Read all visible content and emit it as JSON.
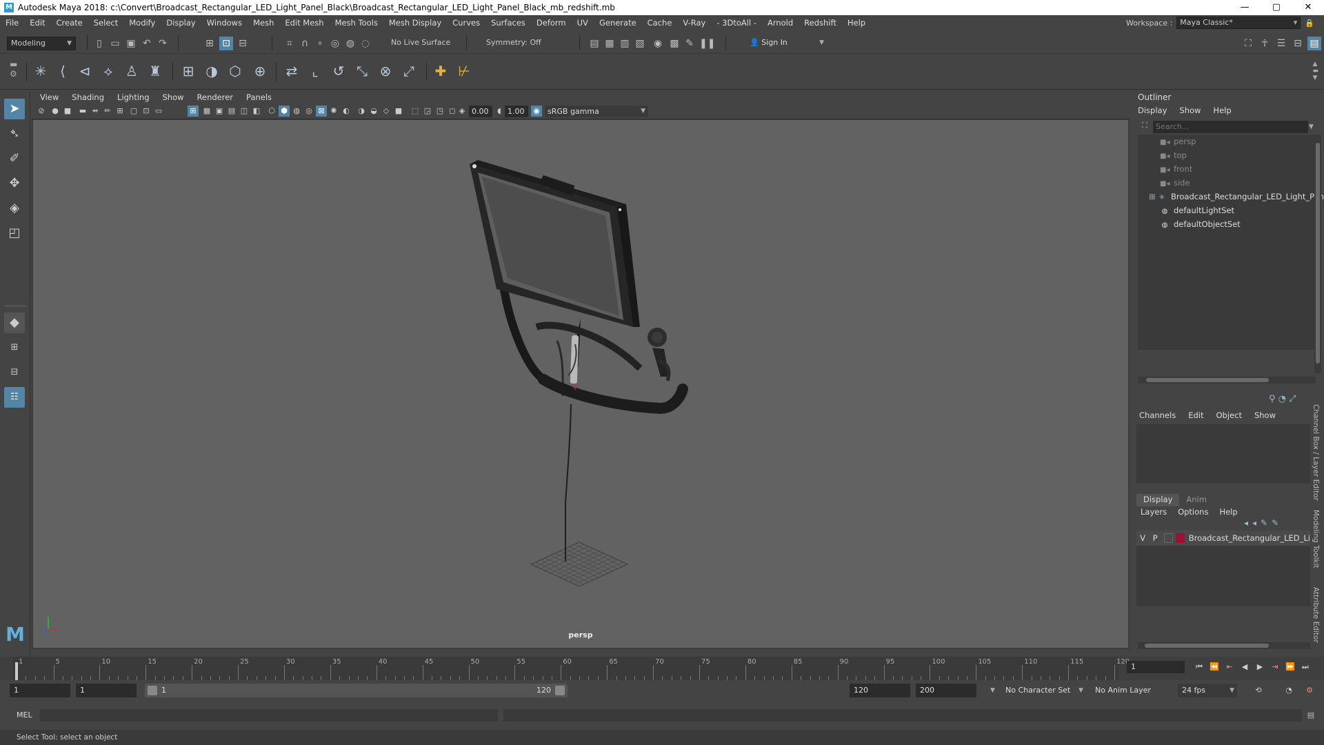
{
  "window": {
    "title": "Autodesk Maya 2018: c:\\Convert\\Broadcast_Rectangular_LED_Light_Panel_Black\\Broadcast_Rectangular_LED_Light_Panel_Black_mb_redshift.mb",
    "minimize": "—",
    "maximize": "▢",
    "close": "✕"
  },
  "menubar": [
    "File",
    "Edit",
    "Create",
    "Select",
    "Modify",
    "Display",
    "Windows",
    "Mesh",
    "Edit Mesh",
    "Mesh Tools",
    "Mesh Display",
    "Curves",
    "Surfaces",
    "Deform",
    "UV",
    "Generate",
    "Cache",
    "V-Ray",
    "- 3DtoAll -",
    "Arnold",
    "Redshift",
    "Help"
  ],
  "workspace": {
    "label": "Workspace :",
    "value": "Maya Classic*"
  },
  "statusline": {
    "mode": "Modeling",
    "live_surface": "No Live Surface",
    "symmetry": "Symmetry: Off",
    "sign_in": "Sign In"
  },
  "viewport": {
    "menu": [
      "View",
      "Shading",
      "Lighting",
      "Show",
      "Renderer",
      "Panels"
    ],
    "exposure": "0.00",
    "gamma": "1.00",
    "color_space": "sRGB gamma",
    "camera_label": "persp"
  },
  "outliner": {
    "title": "Outliner",
    "menu": [
      "Display",
      "Show",
      "Help"
    ],
    "search_placeholder": "Search...",
    "items": [
      {
        "label": "persp",
        "icon": "camera-icon",
        "dim": true
      },
      {
        "label": "top",
        "icon": "camera-icon",
        "dim": true
      },
      {
        "label": "front",
        "icon": "camera-icon",
        "dim": true
      },
      {
        "label": "side",
        "icon": "camera-icon",
        "dim": true
      },
      {
        "label": "Broadcast_Rectangular_LED_Light_Panel",
        "icon": "transform-icon",
        "dim": false
      },
      {
        "label": "defaultLightSet",
        "icon": "set-icon",
        "dim": false
      },
      {
        "label": "defaultObjectSet",
        "icon": "set-icon",
        "dim": false
      }
    ]
  },
  "channel_box": {
    "menu": [
      "Channels",
      "Edit",
      "Object",
      "Show"
    ]
  },
  "layer_editor": {
    "tabs": [
      "Display",
      "Anim"
    ],
    "menu": [
      "Layers",
      "Options",
      "Help"
    ],
    "layer": {
      "v": "V",
      "p": "P",
      "name": "Broadcast_Rectangular_LED_Li",
      "color": "#a01030"
    }
  },
  "side_tabs": [
    "Channel Box / Layer Editor",
    "Modeling Toolkit",
    "Attribute Editor"
  ],
  "timeline": {
    "ticks": [
      "1",
      "5",
      "10",
      "15",
      "20",
      "25",
      "30",
      "35",
      "40",
      "45",
      "50",
      "55",
      "60",
      "65",
      "70",
      "75",
      "80",
      "85",
      "90",
      "95",
      "100",
      "105",
      "110",
      "115",
      "120"
    ],
    "current_frame": "1"
  },
  "range": {
    "start": "1",
    "playback_start": "1",
    "slider_start": "1",
    "slider_end": "120",
    "playback_end": "120",
    "end": "200",
    "character_set": "No Character Set",
    "anim_layer": "No Anim Layer",
    "fps": "24 fps"
  },
  "command": {
    "label": "MEL"
  },
  "help_line": "Select Tool: select an object",
  "colors": {
    "accent": "#5285a6",
    "layer_color": "#a01030"
  }
}
